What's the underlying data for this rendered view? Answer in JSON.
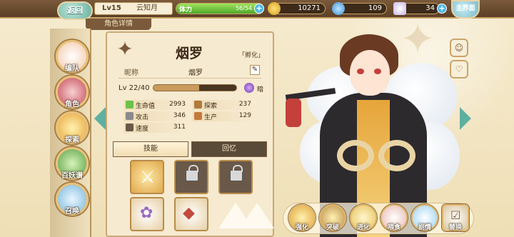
{
  "header": {
    "back_label": "返回",
    "level": "Lv15",
    "player_name": "云知月",
    "stamina_label": "体力",
    "stamina_value": "56/54",
    "stamina_fill": 1.0,
    "coins": "10271",
    "gems": "109",
    "tickets": "34",
    "menu_label": "主界面",
    "section_title": "角色详情"
  },
  "nav": {
    "items": [
      {
        "label": "编队"
      },
      {
        "label": "角色"
      },
      {
        "label": "探索"
      },
      {
        "label": "百妖谱"
      },
      {
        "label": "召唤"
      }
    ]
  },
  "character": {
    "name": "烟罗",
    "tag": "「孵化」",
    "nickname_key": "昵称",
    "nickname_value": "烟罗",
    "level": "Lv 22/40",
    "xp_fill": 0.55,
    "element_label": "暗",
    "stats": [
      {
        "key": "生命值",
        "value": "2993"
      },
      {
        "key": "探索",
        "value": "237"
      },
      {
        "key": "攻击",
        "value": "346"
      },
      {
        "key": "生产",
        "value": "129"
      },
      {
        "key": "速度",
        "value": "311"
      }
    ]
  },
  "tabs": {
    "skill": "技能",
    "memory": "回忆"
  },
  "actions": {
    "items": [
      {
        "label": "强化"
      },
      {
        "label": "突破"
      },
      {
        "label": "进化"
      },
      {
        "label": "喂食"
      },
      {
        "label": "剧情"
      },
      {
        "label": "替换"
      }
    ]
  },
  "colors": {
    "panel_bg": "#f6ead0",
    "accent_brown": "#7a5a3a",
    "teal_arrow": "#5fb0a0"
  }
}
